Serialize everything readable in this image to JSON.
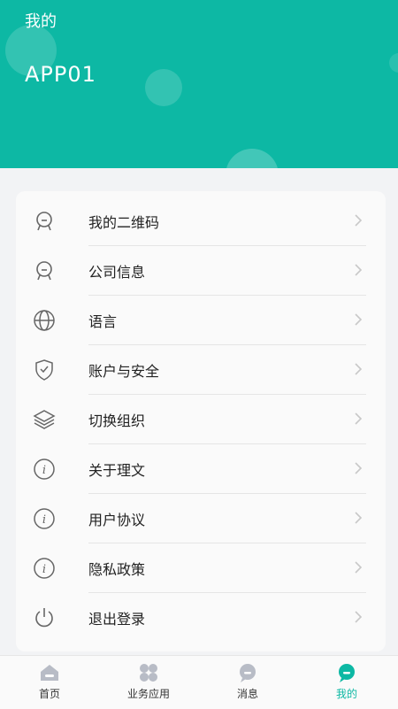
{
  "header": {
    "title": "我的",
    "app_name": "APP01"
  },
  "menu": {
    "items": [
      {
        "label": "我的二维码",
        "icon": "qr-icon"
      },
      {
        "label": "公司信息",
        "icon": "company-icon"
      },
      {
        "label": "语言",
        "icon": "globe-icon"
      },
      {
        "label": "账户与安全",
        "icon": "shield-icon"
      },
      {
        "label": "切换组织",
        "icon": "layers-icon"
      },
      {
        "label": "关于理文",
        "icon": "info-icon"
      },
      {
        "label": "用户协议",
        "icon": "info-icon"
      },
      {
        "label": "隐私政策",
        "icon": "info-icon"
      },
      {
        "label": "退出登录",
        "icon": "power-icon"
      }
    ]
  },
  "tabbar": {
    "tabs": [
      {
        "label": "首页",
        "icon": "home-icon"
      },
      {
        "label": "业务应用",
        "icon": "apps-icon"
      },
      {
        "label": "消息",
        "icon": "message-icon"
      },
      {
        "label": "我的",
        "icon": "profile-icon",
        "active": true
      }
    ]
  },
  "colors": {
    "accent": "#0db8a4",
    "background": "#f2f3f5",
    "card": "#fafafa"
  }
}
